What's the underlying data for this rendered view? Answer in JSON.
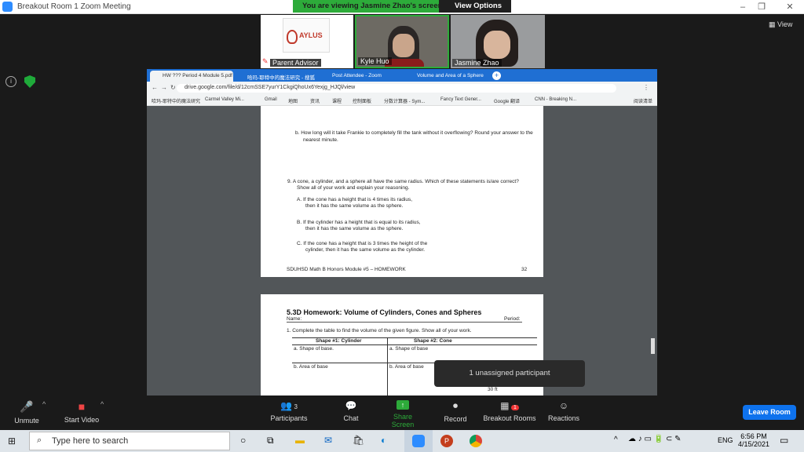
{
  "window": {
    "title": "Breakout Room 1   Zoom Meeting",
    "controls": [
      "–",
      "❐",
      "✕"
    ]
  },
  "banner": {
    "viewing_text": "You are viewing Jasmine Zhao's screen",
    "view_options": "View Options"
  },
  "view_button": "View",
  "participants_tiles": [
    {
      "name": "Parent Advisor"
    },
    {
      "name": "Kyle Huo"
    },
    {
      "name": "Jasmine Zhao"
    }
  ],
  "browser": {
    "tabs": [
      {
        "label": "HW ??? Period 4 Module 5.pdf"
      },
      {
        "label": "哈玛-耶特中的魔法研究 - 搜狐"
      },
      {
        "label": "Post Attendee - Zoom"
      },
      {
        "label": "Volume and Area of a Sphere"
      }
    ],
    "url": "drive.google.com/file/d/12cmSSE7yurY1CkgiQhoUx6Yexjg_HJQl/view",
    "bookmarks": [
      "哈玛-耶特中的魔法研究",
      "Carmel Valley Mi...",
      "Gmail",
      "地图",
      "资讯",
      "课程",
      "控制面板",
      "分数计算器 - Sym...",
      "Fancy Text Gener...",
      "Google 翻译",
      "CNN - Breaking N...",
      "阅读清单"
    ]
  },
  "pdf": {
    "page1": {
      "q8b": "b.   How long will it take Frankie to completely fill the tank without it overflowing? Round your answer to the",
      "q8b_2": "nearest minute.",
      "q9": "9.   A cone, a cylinder, and a sphere all have the same radius. Which of these statements is/are correct?",
      "q9_2": "Show all of your work and explain your reasoning.",
      "qA": "A.   If the cone has a height that is 4 times its radius,",
      "qA_2": "then it has the same volume as the sphere.",
      "qB": "B.   If the cylinder has a height that is equal to its radius,",
      "qB_2": "then it has the same volume as the sphere.",
      "qC": "C.   If the cone has a height that is 3 times the height of the",
      "qC_2": "cylinder, then it has the same volume as the cylinder.",
      "footer": "SDUHSD Math B Honors Module #5 – HOMEWORK",
      "page_num": "32"
    },
    "page2": {
      "title": "5.3D Homework: Volume of Cylinders, Cones and Spheres",
      "name": "Name:",
      "period": "Period:",
      "instruction": "1. Complete the table to find the volume of the given figure. Show all of your work.",
      "col1": "Shape #1: Cylinder",
      "col2": "Shape #2: Cone",
      "a1": "a. Shape of base.",
      "a2": "a. Shape of base",
      "b1": "b. Area of base",
      "b2": "b. Area of base",
      "dim": "30 ft"
    }
  },
  "popup": "1 unassigned participant",
  "toolbar": {
    "unmute": "Unmute",
    "start_video": "Start Video",
    "participants": "Participants",
    "participants_count": "3",
    "chat": "Chat",
    "share_screen": "Share Screen",
    "record": "Record",
    "breakout_rooms": "Breakout Rooms",
    "breakout_badge": "1",
    "reactions": "Reactions",
    "leave": "Leave Room"
  },
  "taskbar": {
    "search_placeholder": "Type here to search",
    "language": "ENG",
    "time": "6:56 PM",
    "date": "4/15/2021"
  },
  "colors": {
    "zoom_blue": "#0e72ed",
    "banner_green": "#2dab3a",
    "chrome_blue": "#1f6fd3"
  }
}
